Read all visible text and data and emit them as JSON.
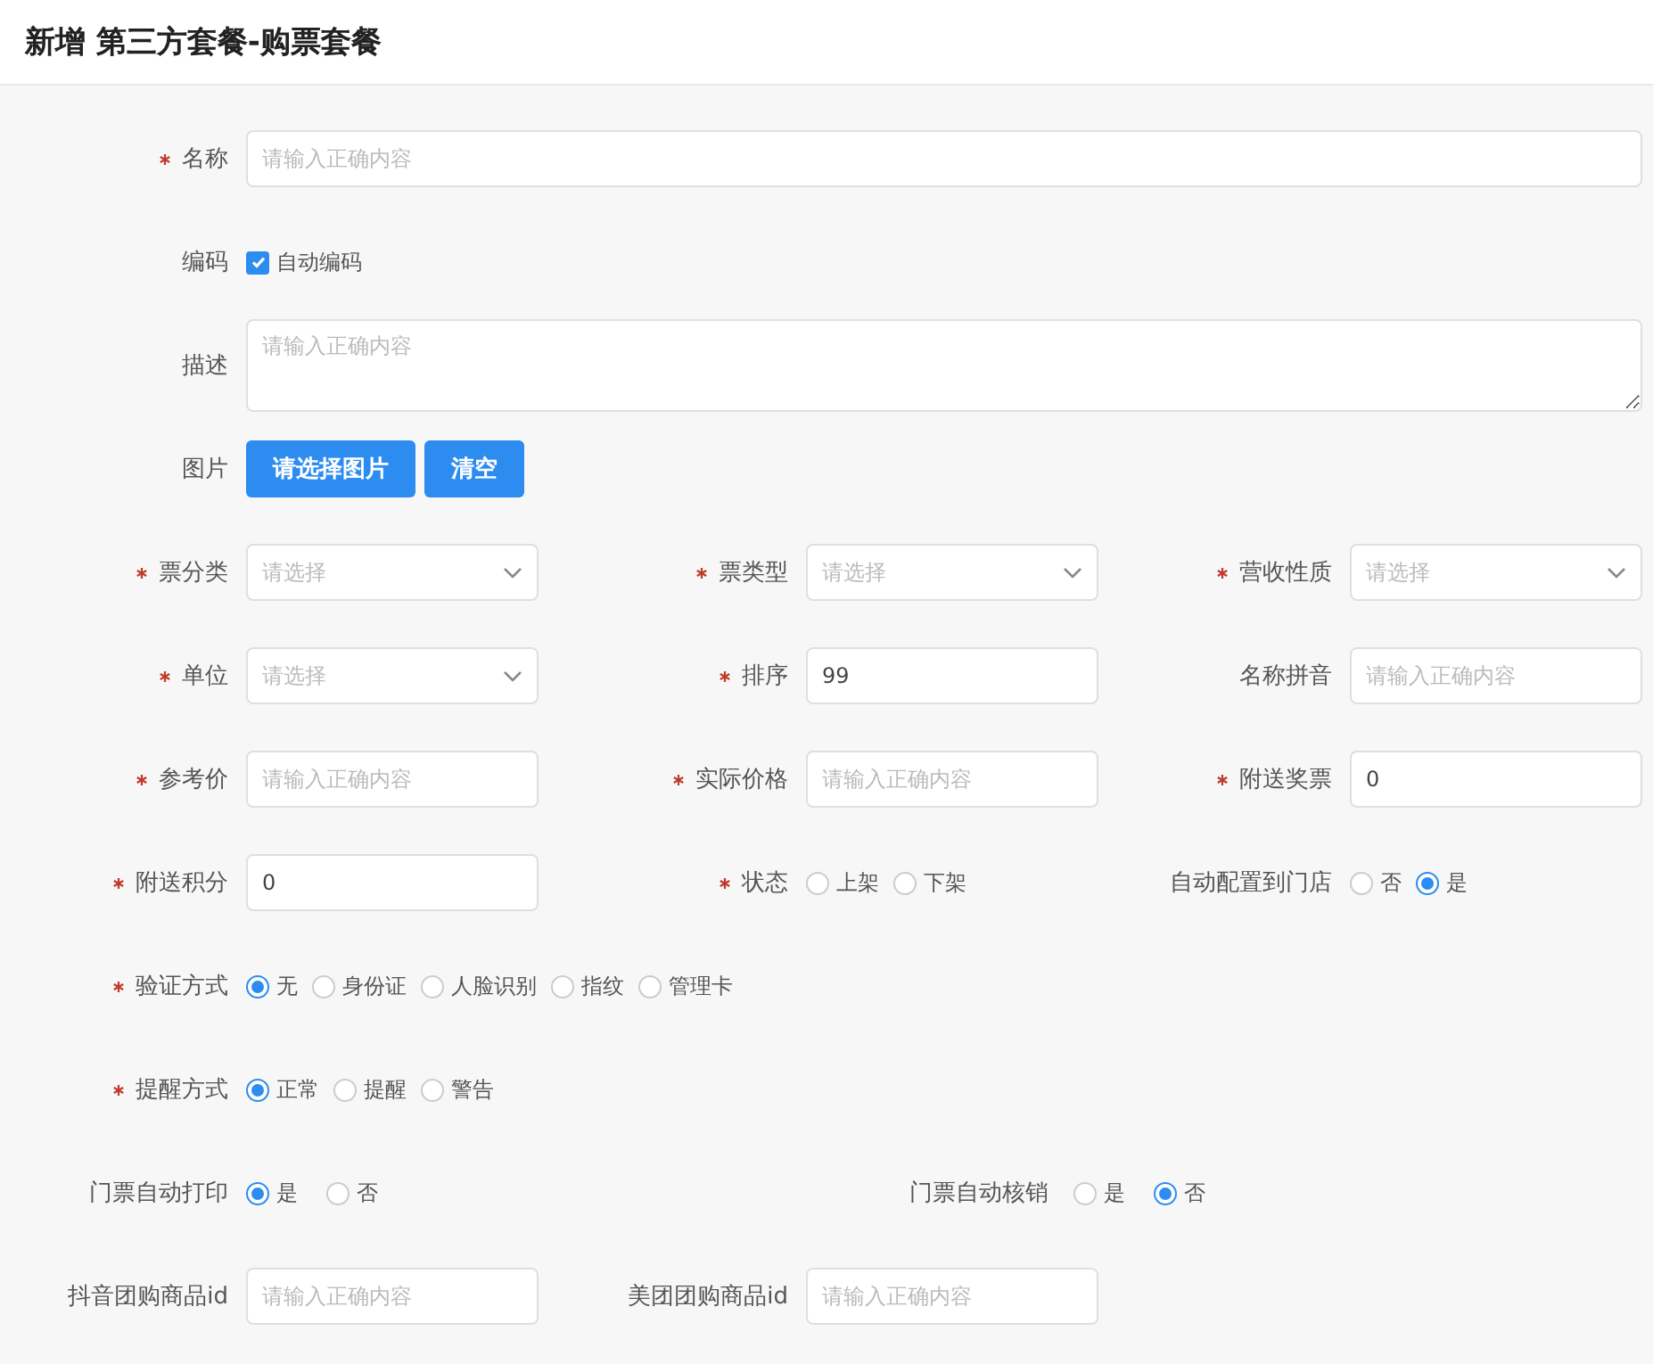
{
  "title": "新增 第三方套餐-购票套餐",
  "rows": [
    {
      "fields": [
        {
          "kind": "input",
          "label": "名称",
          "required": true,
          "placeholder": "请输入正确内容"
        }
      ]
    },
    {
      "fields": [
        {
          "kind": "checkbox",
          "label": "编码",
          "required": false,
          "text": "自动编码",
          "checked": true
        }
      ]
    },
    {
      "fields": [
        {
          "kind": "textarea",
          "label": "描述",
          "required": false,
          "placeholder": "请输入正确内容"
        }
      ]
    },
    {
      "fields": [
        {
          "kind": "buttons",
          "label": "图片",
          "required": false,
          "buttons": [
            "请选择图片",
            "清空"
          ]
        }
      ]
    },
    {
      "fields": [
        {
          "kind": "select",
          "label": "票分类",
          "required": true,
          "placeholder": "请选择"
        },
        {
          "kind": "select",
          "label": "票类型",
          "required": true,
          "placeholder": "请选择"
        },
        {
          "kind": "select",
          "label": "营收性质",
          "required": true,
          "placeholder": "请选择"
        }
      ]
    },
    {
      "fields": [
        {
          "kind": "select",
          "label": "单位",
          "required": true,
          "placeholder": "请选择"
        },
        {
          "kind": "input",
          "label": "排序",
          "required": true,
          "value": "99"
        },
        {
          "kind": "input",
          "label": "名称拼音",
          "required": false,
          "placeholder": "请输入正确内容"
        }
      ]
    },
    {
      "fields": [
        {
          "kind": "input",
          "label": "参考价",
          "required": true,
          "placeholder": "请输入正确内容"
        },
        {
          "kind": "input",
          "label": "实际价格",
          "required": true,
          "placeholder": "请输入正确内容"
        },
        {
          "kind": "input",
          "label": "附送奖票",
          "required": true,
          "value": "0"
        }
      ]
    },
    {
      "fields": [
        {
          "kind": "input",
          "label": "附送积分",
          "required": true,
          "value": "0"
        },
        {
          "kind": "radio",
          "label": "状态",
          "required": true,
          "options": [
            {
              "label": "上架",
              "selected": false
            },
            {
              "label": "下架",
              "selected": false
            }
          ]
        },
        {
          "kind": "radio",
          "label": "自动配置到门店",
          "required": false,
          "options": [
            {
              "label": "否",
              "selected": false
            },
            {
              "label": "是",
              "selected": true
            }
          ]
        }
      ]
    },
    {
      "fields": [
        {
          "kind": "radio",
          "label": "验证方式",
          "required": true,
          "options": [
            {
              "label": "无",
              "selected": true
            },
            {
              "label": "身份证",
              "selected": false
            },
            {
              "label": "人脸识别",
              "selected": false
            },
            {
              "label": "指纹",
              "selected": false
            },
            {
              "label": "管理卡",
              "selected": false
            }
          ]
        }
      ]
    },
    {
      "fields": [
        {
          "kind": "radio",
          "label": "提醒方式",
          "required": true,
          "options": [
            {
              "label": "正常",
              "selected": true
            },
            {
              "label": "提醒",
              "selected": false
            },
            {
              "label": "警告",
              "selected": false
            }
          ]
        }
      ]
    },
    {
      "fields": [
        {
          "kind": "radio",
          "label": "门票自动打印",
          "required": false,
          "options": [
            {
              "label": "是",
              "selected": true
            },
            {
              "label": "否",
              "selected": false
            }
          ]
        },
        {
          "kind": "radio",
          "label": "门票自动核销",
          "required": false,
          "options": [
            {
              "label": "是",
              "selected": false
            },
            {
              "label": "否",
              "selected": true
            }
          ]
        }
      ]
    },
    {
      "fields": [
        {
          "kind": "input",
          "label": "抖音团购商品id",
          "required": false,
          "placeholder": "请输入正确内容"
        },
        {
          "kind": "input",
          "label": "美团团购商品id",
          "required": false,
          "placeholder": "请输入正确内容"
        }
      ]
    }
  ]
}
